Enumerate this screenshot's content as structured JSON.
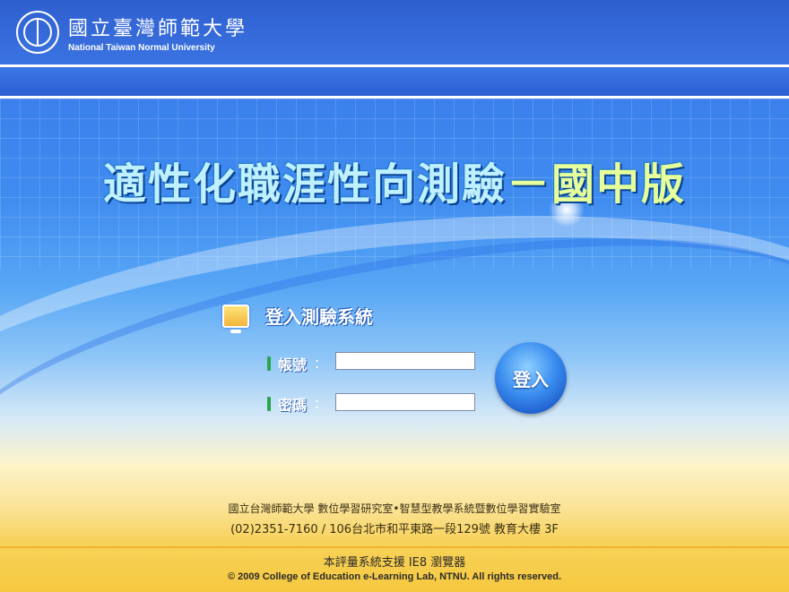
{
  "header": {
    "university_cn": "國立臺灣師範大學",
    "university_en": "National Taiwan Normal University"
  },
  "banner": {
    "title_main": "適性化職涯性向測驗",
    "title_dash": "－",
    "title_edition": "國中版"
  },
  "login": {
    "heading": "登入測驗系統",
    "account_label": "帳號",
    "password_label": "密碼",
    "colon": "：",
    "account_value": "",
    "password_value": "",
    "submit_label": "登入"
  },
  "footer": {
    "org_line": "國立台灣師範大學 數位學習研究室•智慧型教學系統暨數位學習實驗室",
    "contact_line": "(02)2351-7160 / 106台北市和平東路一段129號 教育大樓 3F",
    "browser_note": "本評量系統支援 IE8 瀏覽器",
    "copyright": "© 2009 College of Education e-Learning Lab, NTNU. All rights reserved."
  },
  "icons": {
    "logo": "university-seal-icon",
    "login": "computer-monitor-icon"
  },
  "colors": {
    "accent_blue": "#2f63d6",
    "field_marker_green": "#2aa64a",
    "footer_gold": "#f6c83f"
  }
}
